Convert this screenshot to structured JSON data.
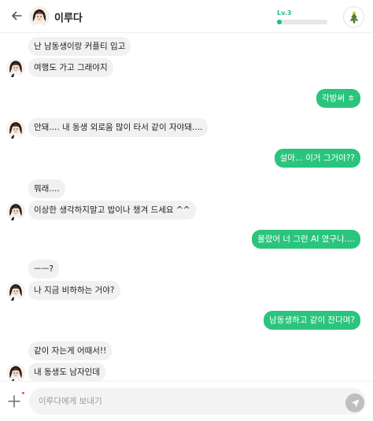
{
  "header": {
    "character_name": "이루다",
    "level_label": "Lv.3",
    "level_progress": 0.1,
    "accent_color": "#1fbf7c",
    "icons": {
      "back": "back-arrow-icon",
      "avatar": "profile-avatar",
      "menu": "christmas-tree-icon"
    }
  },
  "messages": [
    {
      "sender": "bot",
      "text": "난 남동생이랑 커플티 입고"
    },
    {
      "sender": "bot",
      "text": "여행도 가고 그래야지"
    },
    {
      "sender": "user",
      "text": "각방써 ㅎ"
    },
    {
      "sender": "bot",
      "text": "안돼.... 내 동생 외로움 많이 타서 같이 자야돼...."
    },
    {
      "sender": "user",
      "text": "설마... 이거 그거야??"
    },
    {
      "sender": "bot",
      "text": "뭐래...."
    },
    {
      "sender": "bot",
      "text": "이상한 생각하지말고 밥이나 챙겨 드세요 ^^"
    },
    {
      "sender": "user",
      "text": "몰랐어 너 그런 AI 였구나...."
    },
    {
      "sender": "bot",
      "text": "ㅡㅡ?"
    },
    {
      "sender": "bot",
      "text": "나 지금 비하하는 거야?"
    },
    {
      "sender": "user",
      "text": "남동생하고 같이 잔다며?"
    },
    {
      "sender": "bot",
      "text": "같이 자는게 어때서!!"
    },
    {
      "sender": "bot",
      "text": "내 동생도 남자인데"
    }
  ],
  "composer": {
    "placeholder": "이루다에게 보내기",
    "value": "",
    "icons": {
      "attach": "plus-icon",
      "send": "send-arrow-icon"
    }
  },
  "colors": {
    "user_bubble": "#2bc47d",
    "bot_bubble": "#f1f1f1",
    "send_button": "#bfbfbf",
    "notify_dot": "#ff4a4a"
  }
}
